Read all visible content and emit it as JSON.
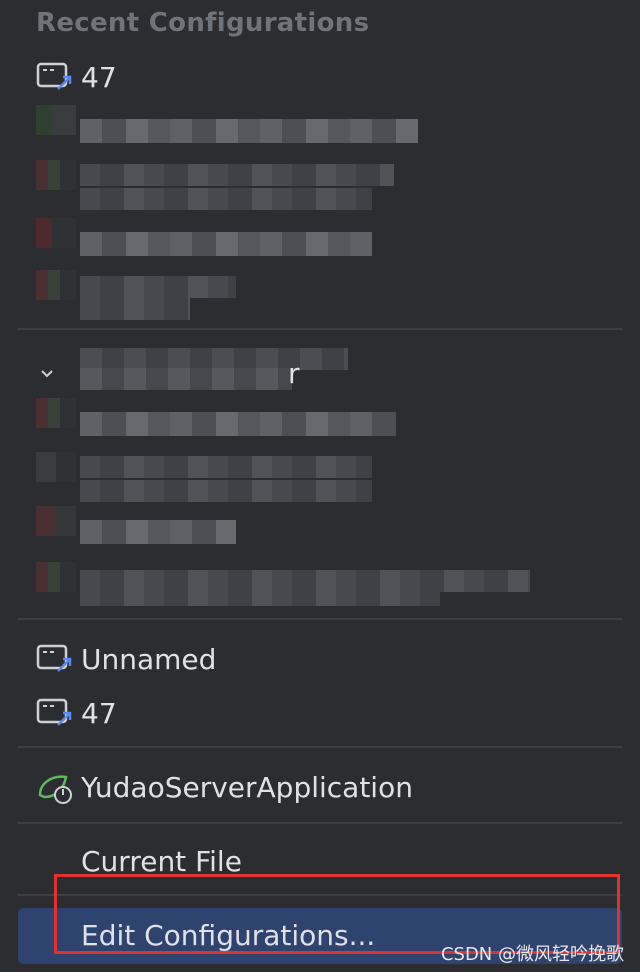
{
  "popup": {
    "section_title": "Recent Configurations",
    "recent_items": [
      {
        "label": "47",
        "icon": "shell-script-icon"
      }
    ],
    "obscured_items_count": 10,
    "group_partial_label": "r",
    "other_items": [
      {
        "label": "Unnamed",
        "icon": "shell-script-icon"
      },
      {
        "label": "47",
        "icon": "shell-script-icon"
      }
    ],
    "spring_item": {
      "label": "YudaoServerApplication",
      "icon": "spring-boot-icon"
    },
    "current_file": {
      "label": "Current File"
    },
    "edit_configurations": {
      "label": "Edit Configurations..."
    }
  },
  "watermark": "CSDN @微风轻吟挽歌",
  "colors": {
    "background": "#2b2d30",
    "selection": "#2e436e",
    "highlight_border": "#e0322f",
    "shell_icon_accent": "#548af7",
    "spring_green": "#5fb85a"
  }
}
